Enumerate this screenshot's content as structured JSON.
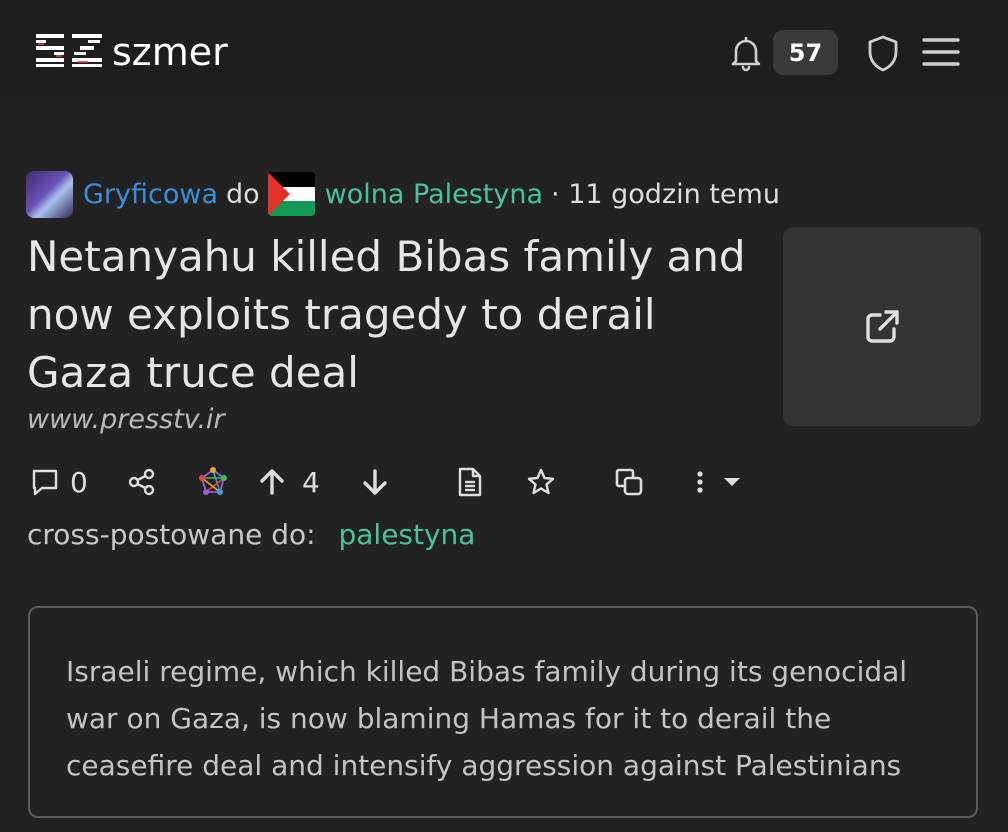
{
  "header": {
    "logo_text": "szmer",
    "notification_count": "57",
    "icons": [
      "bell-icon",
      "shield-icon",
      "hamburger-menu-icon"
    ]
  },
  "post": {
    "author": "Gryficowa",
    "to_word": "do",
    "community": "wolna Palestyna",
    "time": "· 11 godzin temu",
    "title": "Netanyahu killed Bibas family and now exploits tragedy to derail Gaza truce deal",
    "domain": "www.presstv.ir",
    "comment_count": "0",
    "score": "4",
    "crosspost_label": "cross-postowane do:",
    "crosspost_community": "palestyna",
    "body": "Israeli regime, which killed Bibas family during its genocidal war on Gaza, is now blaming Hamas for it to derail the ceasefire deal and intensify aggression against Palestinians"
  },
  "colors": {
    "background": "#222222",
    "author": "#3b8fd9",
    "community": "#46c3a3"
  }
}
